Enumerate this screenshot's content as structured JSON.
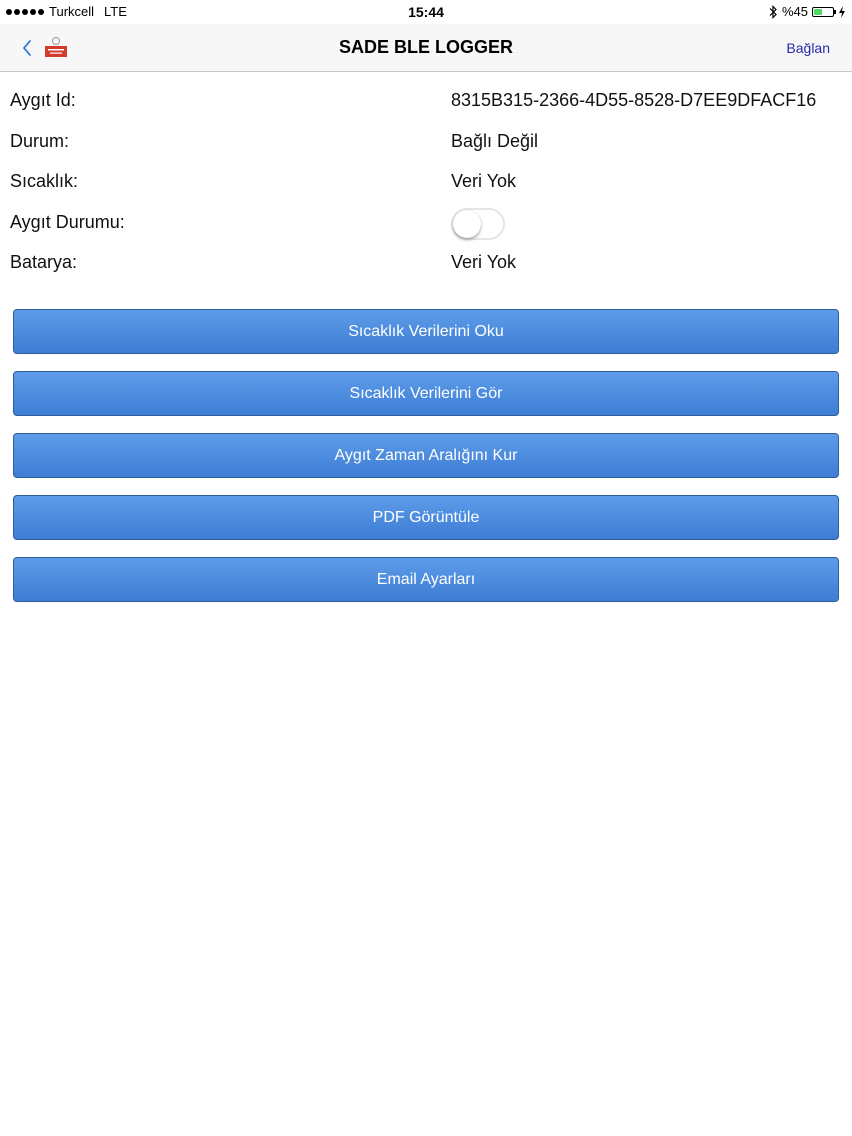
{
  "status_bar": {
    "carrier": "Turkcell",
    "network": "LTE",
    "time": "15:44",
    "battery_text": "%45",
    "battery_level": 0.45
  },
  "nav": {
    "title": "SADE BLE LOGGER",
    "action_label": "Bağlan",
    "accent_color": "#2a2aa8"
  },
  "device_info": {
    "device_id": {
      "label": "Aygıt Id:",
      "value": "8315B315-2366-4D55-8528-D7EE9DFACF16"
    },
    "status": {
      "label": "Durum:",
      "value": "Bağlı Değil"
    },
    "temperature": {
      "label": "Sıcaklık:",
      "value": "Veri Yok"
    },
    "device_state": {
      "label": "Aygıt Durumu:",
      "toggle_on": false
    },
    "battery": {
      "label": "Batarya:",
      "value": "Veri Yok"
    }
  },
  "buttons": [
    {
      "label": "Sıcaklık Verilerini Oku"
    },
    {
      "label": "Sıcaklık Verilerini Gör"
    },
    {
      "label": "Aygıt Zaman Aralığını Kur"
    },
    {
      "label": "PDF Görüntüle"
    },
    {
      "label": "Email Ayarları"
    }
  ],
  "colors": {
    "button_top": "#5e9ce9",
    "button_bottom": "#3d7dd4",
    "button_border": "#2c5d9f",
    "battery_fill": "#4cd964"
  },
  "icons": [
    "signal-icon",
    "bluetooth-icon",
    "battery-icon",
    "charging-icon",
    "back-chevron-icon",
    "logo-icon"
  ]
}
